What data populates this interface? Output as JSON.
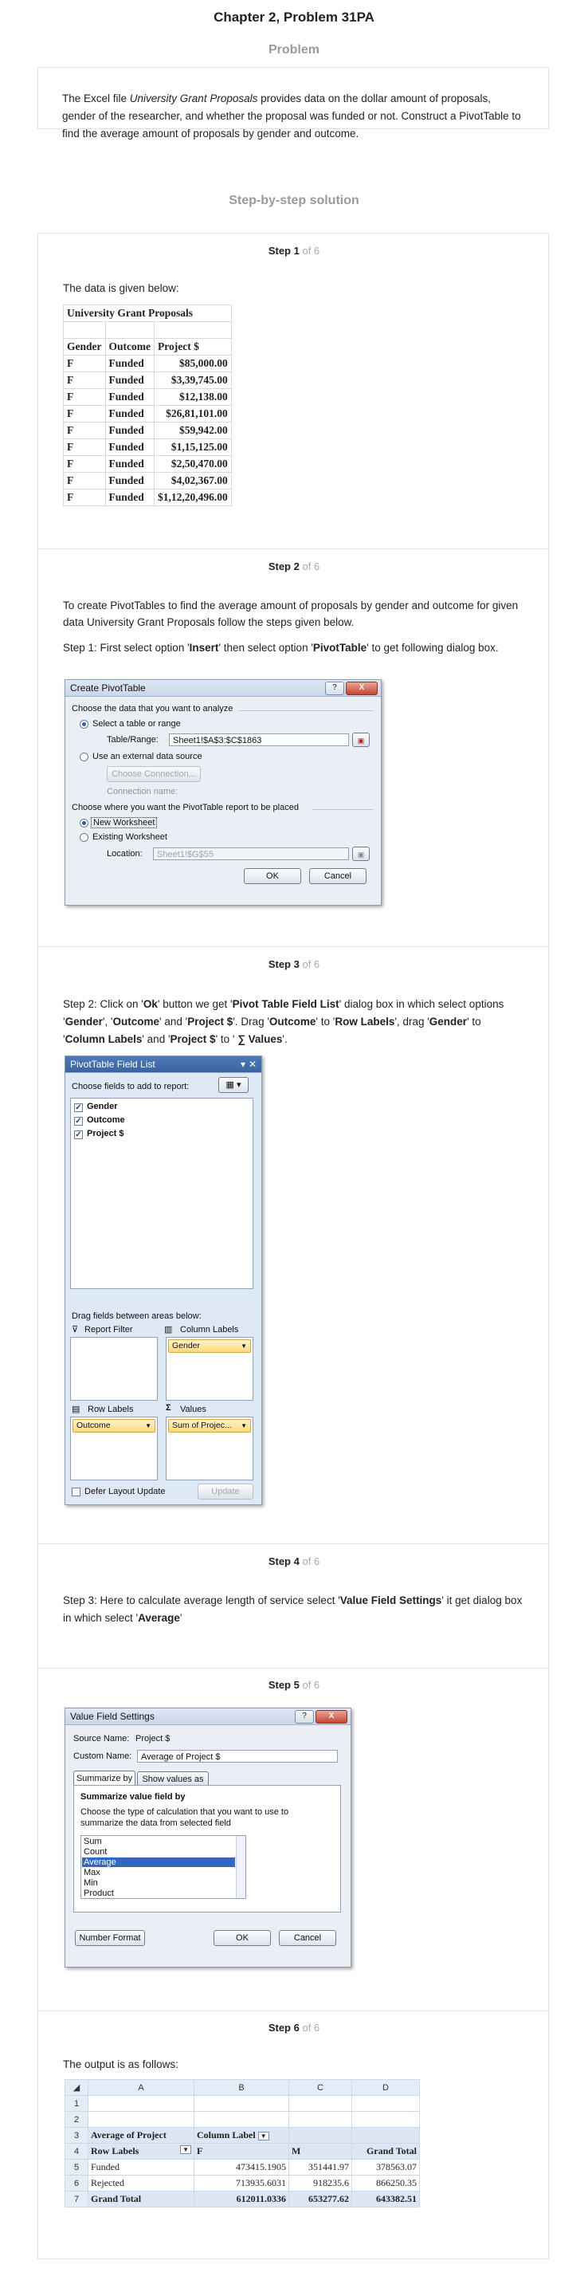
{
  "header": {
    "title": "Chapter 2, Problem 31PA",
    "problem_heading": "Problem",
    "problem_text_1": "The Excel file ",
    "problem_text_italic": "University Grant Proposals",
    "problem_text_2": " provides data on the dollar amount of proposals, gender of the researcher, and whether the proposal was funded or not. Construct a PivotTable to find the average amount of proposals by gender and outcome.",
    "solution_heading": "Step-by-step solution"
  },
  "steps": [
    {
      "label": "Step 1",
      "of": "of 6"
    },
    {
      "label": "Step 2",
      "of": "of 6"
    },
    {
      "label": "Step 3",
      "of": "of 6"
    },
    {
      "label": "Step 4",
      "of": "of 6"
    },
    {
      "label": "Step 5",
      "of": "of 6"
    },
    {
      "label": "Step 6",
      "of": "of 6"
    }
  ],
  "step1": {
    "intro": "The data is given below:",
    "table_title": "University Grant Proposals",
    "headers": [
      "Gender",
      "Outcome",
      "Project $"
    ],
    "rows": [
      [
        "F",
        "Funded",
        "$85,000.00"
      ],
      [
        "F",
        "Funded",
        "$3,39,745.00"
      ],
      [
        "F",
        "Funded",
        "$12,138.00"
      ],
      [
        "F",
        "Funded",
        "$26,81,101.00"
      ],
      [
        "F",
        "Funded",
        "$59,942.00"
      ],
      [
        "F",
        "Funded",
        "$1,15,125.00"
      ],
      [
        "F",
        "Funded",
        "$2,50,470.00"
      ],
      [
        "F",
        "Funded",
        "$4,02,367.00"
      ],
      [
        "F",
        "Funded",
        "$1,12,20,496.00"
      ]
    ]
  },
  "step2": {
    "text1": "To create PivotTables to find the average amount of proposals by gender and outcome for given data University Grant Proposals follow the steps given below.",
    "text2_a": "Step 1: First select option '",
    "text2_b": "Insert",
    "text2_c": "' then select option '",
    "text2_d": "PivotTable",
    "text2_e": "' to get following dialog box.",
    "dialog": {
      "title": "Create PivotTable",
      "help": "?",
      "close": "X",
      "section1": "Choose the data that you want to analyze",
      "opt_select": "Select a table or range",
      "table_range_label": "Table/Range:",
      "table_range_value": "Sheet1!$A$3:$C$1863",
      "opt_external": "Use an external data source",
      "choose_connection": "Choose Connection...",
      "connection_name": "Connection name:",
      "section2": "Choose where you want the PivotTable report to be placed",
      "opt_new": "New Worksheet",
      "opt_existing": "Existing Worksheet",
      "location_label": "Location:",
      "location_value": "Sheet1!$G$55",
      "ok": "OK",
      "cancel": "Cancel"
    }
  },
  "step3": {
    "t1": "Step 2: Click on '",
    "t2": "Ok",
    "t3": "' button we get '",
    "t4": "Pivot Table Field List",
    "t5": "' dialog box in which select options '",
    "t6": "Gender",
    "t7": "', '",
    "t8": "Outcome",
    "t9": "' and '",
    "t10": "Project $",
    "t11": "'. Drag '",
    "t12": "Outcome",
    "t13": "' to '",
    "t14": "Row Labels",
    "t15": "', drag '",
    "t16": "Gender",
    "t17": "' to '",
    "t18": "Column Labels",
    "t19": "' and '",
    "t20": "Project $",
    "t21": "' to '",
    "t22": " ∑ Values",
    "t23": "'.",
    "panel": {
      "title": "PivotTable Field List",
      "choose": "Choose fields to add to report:",
      "fields": [
        "Gender",
        "Outcome",
        "Project $"
      ],
      "drag": "Drag fields between areas below:",
      "report_filter": "Report Filter",
      "column_labels": "Column Labels",
      "row_labels": "Row Labels",
      "values": "Values",
      "col_pill": "Gender",
      "row_pill": "Outcome",
      "val_pill": "Sum of Projec...",
      "defer": "Defer Layout Update",
      "update": "Update"
    }
  },
  "step4": {
    "t1": "Step 3: Here to calculate average length of service select '",
    "t2": "Value Field Settings",
    "t3": "' it get dialog box in which select '",
    "t4": "Average",
    "t5": "'"
  },
  "step5": {
    "dialog": {
      "title": "Value Field Settings",
      "help": "?",
      "close": "X",
      "source_name_label": "Source Name:",
      "source_name_value": "Project $",
      "custom_name_label": "Custom Name:",
      "custom_name_value": "Average of Project $",
      "tab1": "Summarize by",
      "tab2": "Show values as",
      "group_title": "Summarize value field by",
      "desc": "Choose the type of calculation that you want to use to summarize the data from selected field",
      "options": [
        "Sum",
        "Count",
        "Average",
        "Max",
        "Min",
        "Product"
      ],
      "selected": "Average",
      "number_format": "Number Format",
      "ok": "OK",
      "cancel": "Cancel"
    }
  },
  "step6": {
    "intro": "The output is as follows:",
    "col_headers": [
      "A",
      "B",
      "C",
      "D"
    ],
    "row_numbers": [
      "1",
      "2",
      "3",
      "4",
      "5",
      "6",
      "7"
    ],
    "r3a": "Average of Project",
    "r3b": "Column Label",
    "r4a": "Row Labels",
    "r4b": "F",
    "r4c": "M",
    "r4d": "Grand Total",
    "r5": [
      "Funded",
      "473415.1905",
      "351441.97",
      "378563.07"
    ],
    "r6": [
      "Rejected",
      "713935.6031",
      "918235.6",
      "866250.35"
    ],
    "r7": [
      "Grand Total",
      "612011.0336",
      "653277.62",
      "643382.51"
    ]
  }
}
